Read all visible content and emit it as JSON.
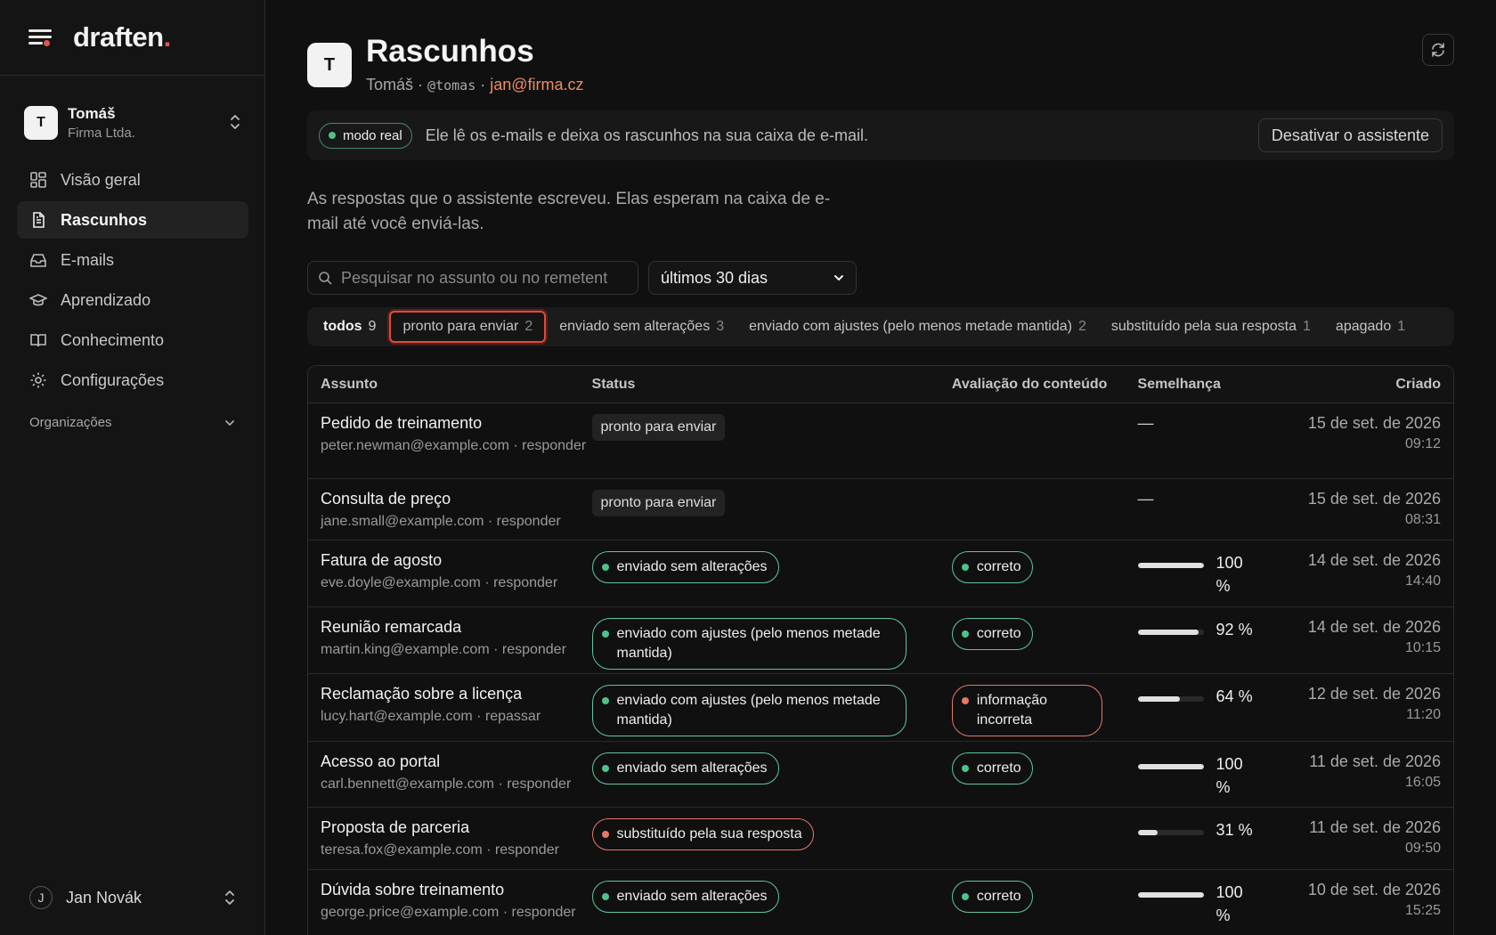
{
  "brand": {
    "name": "draften",
    "dot": "."
  },
  "org": {
    "initial": "T",
    "name": "Tomáš",
    "company": "Firma Ltda."
  },
  "nav": [
    {
      "label": "Visão geral",
      "icon": "dashboard-icon"
    },
    {
      "label": "Rascunhos",
      "icon": "document-icon",
      "active": true
    },
    {
      "label": "E-mails",
      "icon": "inbox-icon"
    },
    {
      "label": "Aprendizado",
      "icon": "graduation-cap-icon"
    },
    {
      "label": "Conhecimento",
      "icon": "book-icon"
    },
    {
      "label": "Configurações",
      "icon": "gear-icon"
    }
  ],
  "organizations_label": "Organizações",
  "user": {
    "initial": "J",
    "name": "Jan Novák"
  },
  "header": {
    "initial": "T",
    "title": "Rascunhos",
    "name": "Tomáš",
    "sep": "·",
    "handle": "@tomas",
    "email": "jan@firma.cz"
  },
  "mode": {
    "badge": "modo real",
    "text": "Ele lê os e-mails e deixa os rascunhos na sua caixa de e-mail.",
    "button": "Desativar o assistente"
  },
  "intro": "As respostas que o assistente escreveu. Elas esperam na caixa de e-mail até você enviá-las.",
  "search": {
    "placeholder": "Pesquisar no assunto ou no remetent"
  },
  "range": {
    "selected": "últimos 30 dias"
  },
  "tabs": [
    {
      "label": "todos",
      "count": "9"
    },
    {
      "label": "pronto para enviar",
      "count": "2"
    },
    {
      "label": "enviado sem alterações",
      "count": "3"
    },
    {
      "label": "enviado com ajustes (pelo menos metade mantida)",
      "count": "2"
    },
    {
      "label": "substituído pela sua resposta",
      "count": "1"
    },
    {
      "label": "apagado",
      "count": "1"
    }
  ],
  "columns": [
    "Assunto",
    "Status",
    "Avaliação do conteúdo",
    "Semelhança",
    "Criado"
  ],
  "rows": [
    {
      "subject": "Pedido de treinamento",
      "from": "peter.newman@example.com · responder",
      "status": "pronto para enviar",
      "status_kind": "plain",
      "eval": "",
      "eval_kind": "",
      "similarity": null,
      "sim_text": "—",
      "date": "15 de set. de 2026",
      "time": "09:12",
      "h": 85
    },
    {
      "subject": "Consulta de preço",
      "from": "jane.small@example.com · responder",
      "status": "pronto para enviar",
      "status_kind": "plain",
      "eval": "",
      "eval_kind": "",
      "similarity": null,
      "sim_text": "—",
      "date": "15 de set. de 2026",
      "time": "08:31",
      "h": 69
    },
    {
      "subject": "Fatura de agosto",
      "from": "eve.doyle@example.com · responder",
      "status": "enviado sem alterações",
      "status_kind": "green",
      "eval": "correto",
      "eval_kind": "green",
      "similarity": 100,
      "sim_text": "100 %",
      "date": "14 de set. de 2026",
      "time": "14:40",
      "h": 75
    },
    {
      "subject": "Reunião remarcada",
      "from": "martin.king@example.com · responder",
      "status": "enviado com ajustes (pelo menos metade mantida)",
      "status_kind": "green",
      "eval": "correto",
      "eval_kind": "green",
      "similarity": 92,
      "sim_text": "92 %",
      "date": "14 de set. de 2026",
      "time": "10:15",
      "h": 75
    },
    {
      "subject": "Reclamação sobre a licença",
      "from": "lucy.hart@example.com · repassar",
      "status": "enviado com ajustes (pelo menos metade mantida)",
      "status_kind": "green",
      "eval": "informação incorreta",
      "eval_kind": "red",
      "similarity": 64,
      "sim_text": "64 %",
      "date": "12 de set. de 2026",
      "time": "11:20",
      "h": 76
    },
    {
      "subject": "Acesso ao portal",
      "from": "carl.bennett@example.com · responder",
      "status": "enviado sem alterações",
      "status_kind": "green",
      "eval": "correto",
      "eval_kind": "green",
      "similarity": 100,
      "sim_text": "100 %",
      "date": "11 de set. de 2026",
      "time": "16:05",
      "h": 74
    },
    {
      "subject": "Proposta de parceria",
      "from": "teresa.fox@example.com · responder",
      "status": "substituído pela sua resposta",
      "status_kind": "red",
      "eval": "",
      "eval_kind": "",
      "similarity": 31,
      "sim_text": "31 %",
      "date": "11 de set. de 2026",
      "time": "09:50",
      "h": 70
    },
    {
      "subject": "Dúvida sobre treinamento",
      "from": "george.price@example.com · responder",
      "status": "enviado sem alterações",
      "status_kind": "green",
      "eval": "correto",
      "eval_kind": "green",
      "similarity": 100,
      "sim_text": "100 %",
      "date": "10 de set. de 2026",
      "time": "15:25",
      "h": 75
    }
  ]
}
